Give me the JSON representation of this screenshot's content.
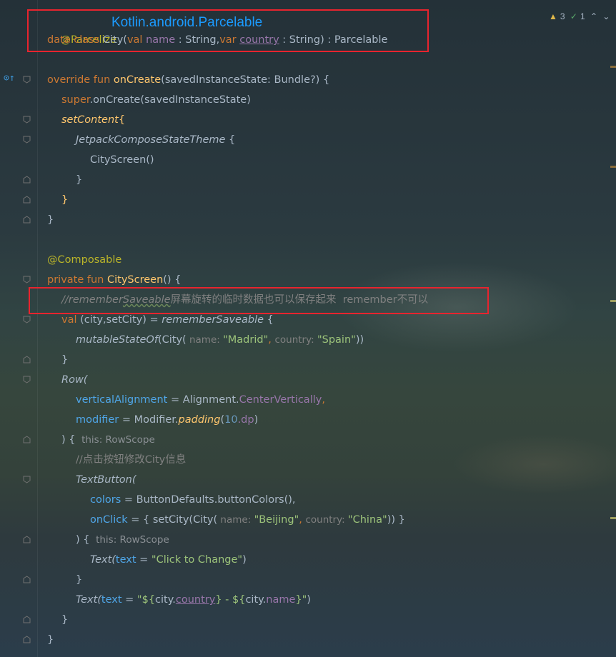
{
  "annotation": {
    "label": "Kotlin.android.Parcelable"
  },
  "status": {
    "warnings": "3",
    "weak_warnings": "1"
  },
  "code": {
    "l1_annotation": "@Parcelize",
    "l2_data": "data class ",
    "l2_city": "City(",
    "l2_val": "val ",
    "l2_name": "name",
    "l2_mid": " : String,",
    "l2_var": "var ",
    "l2_country": "country",
    "l2_end": " : String) : Parcelable",
    "l4_override": "override fun ",
    "l4_fn": "onCreate",
    "l4_rest": "(savedInstanceState: Bundle?) {",
    "l5_super": "super",
    "l5_rest": ".onCreate(savedInstanceState)",
    "l6_setcontent": "setContent",
    "l6_brace": "{",
    "l7_theme": "JetpackComposeStateTheme",
    "l7_brace": " {",
    "l8_call": "CityScreen()",
    "close": "}",
    "l13_ann": "@Composable",
    "l14_private": "private fun ",
    "l14_fn": "CityScreen",
    "l14_rest": "() {",
    "l15_comment_a": "//remember",
    "l15_comment_b": "Saveable",
    "l15_comment_c": "屏幕旋转的临时数据也可以保存起来  remember不可以",
    "l16_val": "val ",
    "l16_a": "(city,setCity) = ",
    "l16_fn": "rememberSaveable",
    "l16_brace": " {",
    "l17_mut": "mutableStateOf",
    "l17_city": "(City(",
    "l17_hint_name": " name: ",
    "l17_madrid": "\"Madrid\"",
    "l17_comma": ", ",
    "l17_hint_country": "country: ",
    "l17_spain": "\"Spain\"",
    "l17_end": "))",
    "l19_row": "Row(",
    "l20_prop": "verticalAlignment",
    "l20_eq": " = Alignment.",
    "l20_val": "CenterVertically",
    "l20_comma": ",",
    "l21_prop": "modifier",
    "l21_eq": " = Modifier.",
    "l21_fn": "padding",
    "l21_open": "(",
    "l21_num": "10",
    "l21_dp": ".dp",
    "l21_close": ")",
    "l22_brace": ") {",
    "l22_hint": "  this: RowScope",
    "l23_comment": "//点击按钮修改City信息",
    "l24_btn": "TextButton(",
    "l25_prop": "colors",
    "l25_eq": " = ButtonDefaults.buttonColors(),",
    "l26_prop": "onClick",
    "l26_eq": " = { setCity(City(",
    "l26_hint_name": " name: ",
    "l26_beijing": "\"Beijing\"",
    "l26_comma": ", ",
    "l26_hint_country": "country: ",
    "l26_china": "\"China\"",
    "l26_end": ")) }",
    "l27_brace": ") {",
    "l27_hint": "  this: RowScope",
    "l28_text": "Text(",
    "l28_prop": "text",
    "l28_eq": " = ",
    "l28_str": "\"Click to Change\"",
    "l28_end": ")",
    "l30_text": "Text(",
    "l30_prop": "text",
    "l30_eq": " = ",
    "l30_s1": "\"${",
    "l30_city": "city.",
    "l30_country": "country",
    "l30_s2": "} - ${",
    "l30_city2": "city.",
    "l30_name": "name",
    "l30_s3": "}\"",
    "l30_end": ")"
  },
  "colors": {
    "highlight_box": "#e8242e",
    "annotation_text": "#1b9bff"
  }
}
